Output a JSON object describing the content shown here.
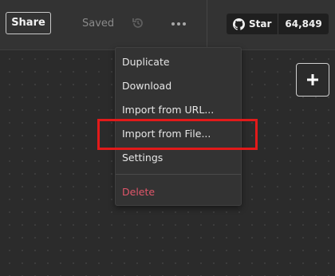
{
  "toolbar": {
    "share_label": "Share",
    "saved_label": "Saved",
    "history_icon": "history-icon",
    "more_icon": "more-horizontal-icon"
  },
  "github": {
    "icon": "github-icon",
    "star_label": "Star",
    "star_count": "64,849"
  },
  "canvas": {
    "add_icon": "plus-icon"
  },
  "menu": {
    "items": [
      {
        "label": "Duplicate"
      },
      {
        "label": "Download"
      },
      {
        "label": "Import from URL..."
      },
      {
        "label": "Import from File..."
      },
      {
        "label": "Settings"
      }
    ],
    "delete_label": "Delete",
    "delete_color": "#e0566a"
  },
  "annotation": {
    "highlight_color": "#e21a1a",
    "highlighted_item": "Import from File..."
  },
  "colors": {
    "background": "#2b2b2b",
    "topbar": "#333333",
    "menu_bg": "#333333"
  }
}
